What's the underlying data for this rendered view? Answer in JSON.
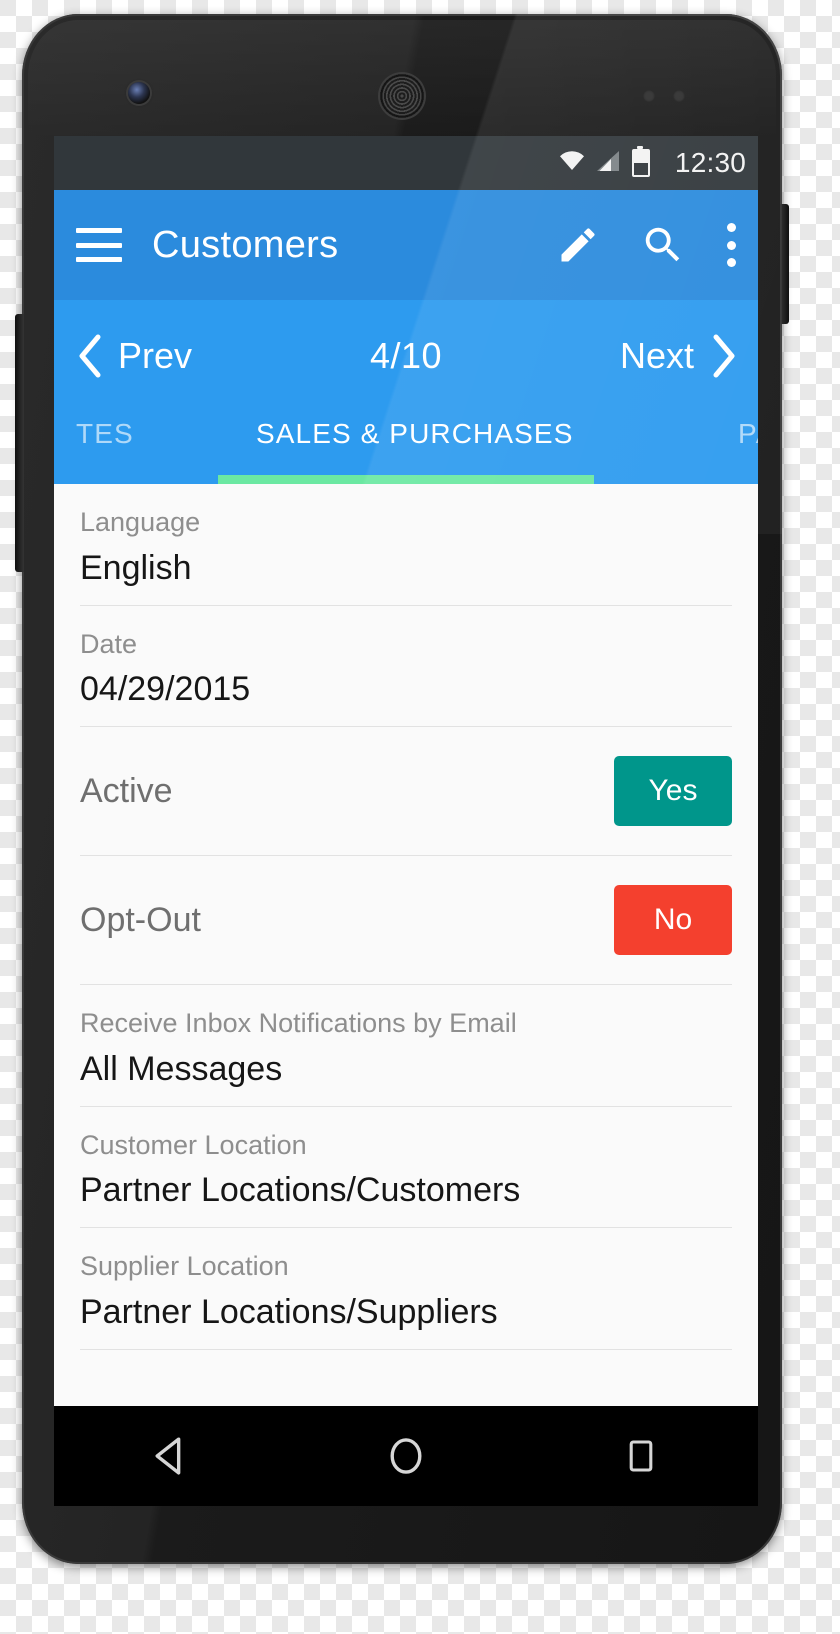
{
  "device": {
    "camera_icon": "front-camera",
    "speaker_icon": "earpiece-speaker",
    "sensor_icon": "proximity-sensor"
  },
  "statusbar": {
    "wifi_icon": "wifi-icon",
    "signal_icon": "cellular-signal-icon",
    "battery_icon": "battery-icon",
    "clock": "12:30"
  },
  "appbar": {
    "menu_icon": "hamburger-menu-icon",
    "title": "Customers",
    "edit_icon": "pencil-edit-icon",
    "search_icon": "search-icon",
    "overflow_icon": "overflow-menu-icon"
  },
  "pager": {
    "prev_label": "Prev",
    "prev_icon": "chevron-left-icon",
    "count": "4/10",
    "next_label": "Next",
    "next_icon": "chevron-right-icon"
  },
  "tabs": {
    "items": [
      {
        "label": "TES",
        "active": false
      },
      {
        "label": "SALES & PURCHASES",
        "active": true
      },
      {
        "label": "PAY",
        "active": false
      }
    ],
    "indicator_color": "#6be8a2"
  },
  "form": {
    "fields": [
      {
        "label": "Language",
        "value": "English"
      },
      {
        "label": "Date",
        "value": "04/29/2015"
      },
      {
        "label": "Receive Inbox Notifications by Email",
        "value": "All Messages"
      },
      {
        "label": "Customer Location",
        "value": "Partner Locations/Customers"
      },
      {
        "label": "Supplier Location",
        "value": "Partner Locations/Suppliers"
      }
    ],
    "toggles": [
      {
        "label": "Active",
        "value": "Yes",
        "color": "#00968b"
      },
      {
        "label": "Opt-Out",
        "value": "No",
        "color": "#f4402e"
      }
    ]
  },
  "navbar": {
    "back_icon": "back-triangle-icon",
    "home_icon": "home-circle-icon",
    "recents_icon": "recents-square-icon"
  },
  "colors": {
    "appbar_blue": "#2b8bdd",
    "pager_blue": "#2d9bef",
    "accent_green": "#6be8a2",
    "content_bg": "#fafafa",
    "statusbar": "#31373b"
  }
}
